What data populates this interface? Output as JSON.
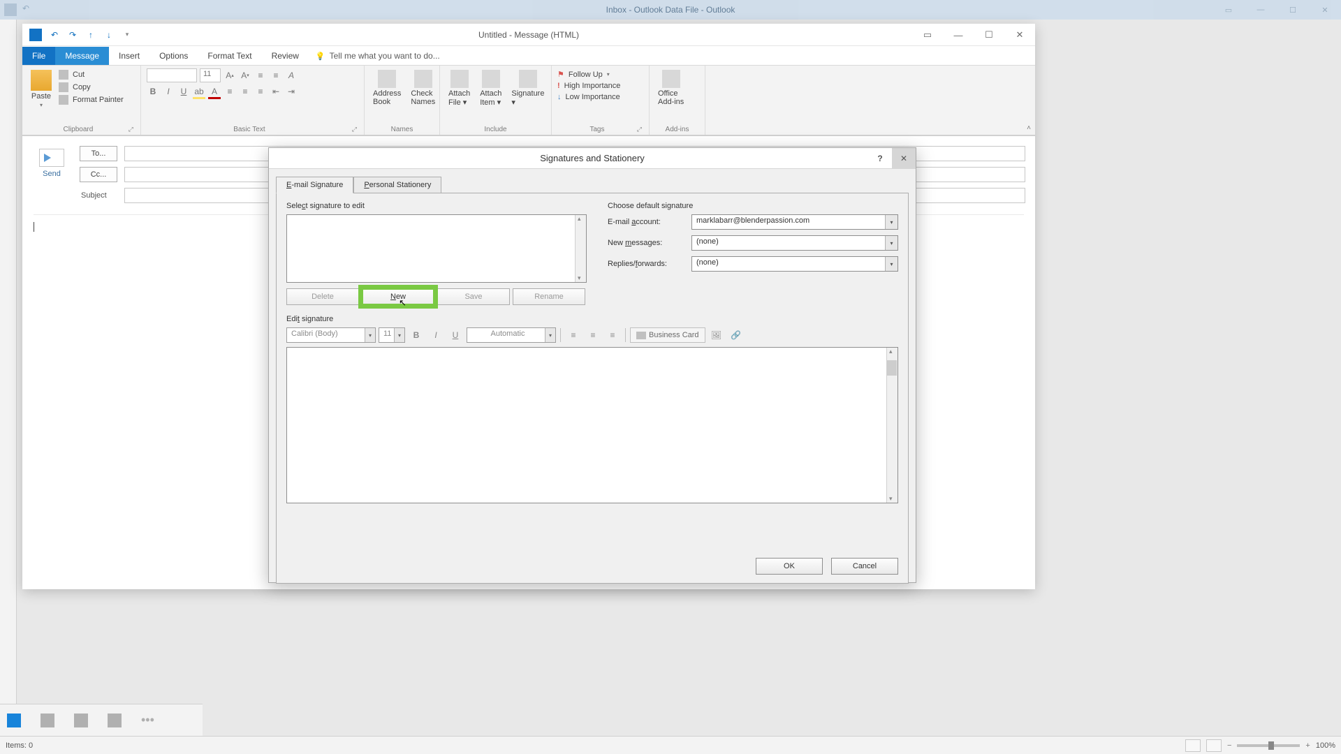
{
  "main_window": {
    "title": "Inbox - Outlook Data File - Outlook",
    "status_items": "Items: 0",
    "zoom": "100%"
  },
  "msg_window": {
    "title": "Untitled - Message (HTML)",
    "tabs": {
      "file": "File",
      "message": "Message",
      "insert": "Insert",
      "options": "Options",
      "format": "Format Text",
      "review": "Review",
      "tell": "Tell me what you want to do..."
    },
    "clipboard": {
      "paste": "Paste",
      "cut": "Cut",
      "copy": "Copy",
      "fp": "Format Painter",
      "label": "Clipboard"
    },
    "basic_text": {
      "font_size": "11",
      "label": "Basic Text"
    },
    "names": {
      "ab": "Address Book",
      "cn": "Check Names",
      "label": "Names"
    },
    "include": {
      "af": "Attach File",
      "ai": "Attach Item",
      "sig": "Signature",
      "label": "Include"
    },
    "tags": {
      "fu": "Follow Up",
      "hi": "High Importance",
      "lo": "Low Importance",
      "label": "Tags"
    },
    "addins": {
      "oa": "Office Add-ins",
      "label": "Add-ins"
    },
    "compose": {
      "send": "Send",
      "to": "To...",
      "cc": "Cc...",
      "subject": "Subject"
    }
  },
  "dialog": {
    "title": "Signatures and Stationery",
    "tabs": {
      "email": "E-mail Signature",
      "personal": "Personal Stationery"
    },
    "select_label": "Select signature to edit",
    "choose_label": "Choose default signature",
    "email_account_label": "E-mail account:",
    "email_account_value": "marklabarr@blenderpassion.com",
    "new_messages_label": "New messages:",
    "new_messages_value": "(none)",
    "replies_label": "Replies/forwards:",
    "replies_value": "(none)",
    "btn_delete": "Delete",
    "btn_new": "New",
    "btn_save": "Save",
    "btn_rename": "Rename",
    "edit_label": "Edit signature",
    "toolbar": {
      "font": "Calibri (Body)",
      "size": "11",
      "color": "Automatic",
      "bcard": "Business Card"
    },
    "ok": "OK",
    "cancel": "Cancel"
  }
}
